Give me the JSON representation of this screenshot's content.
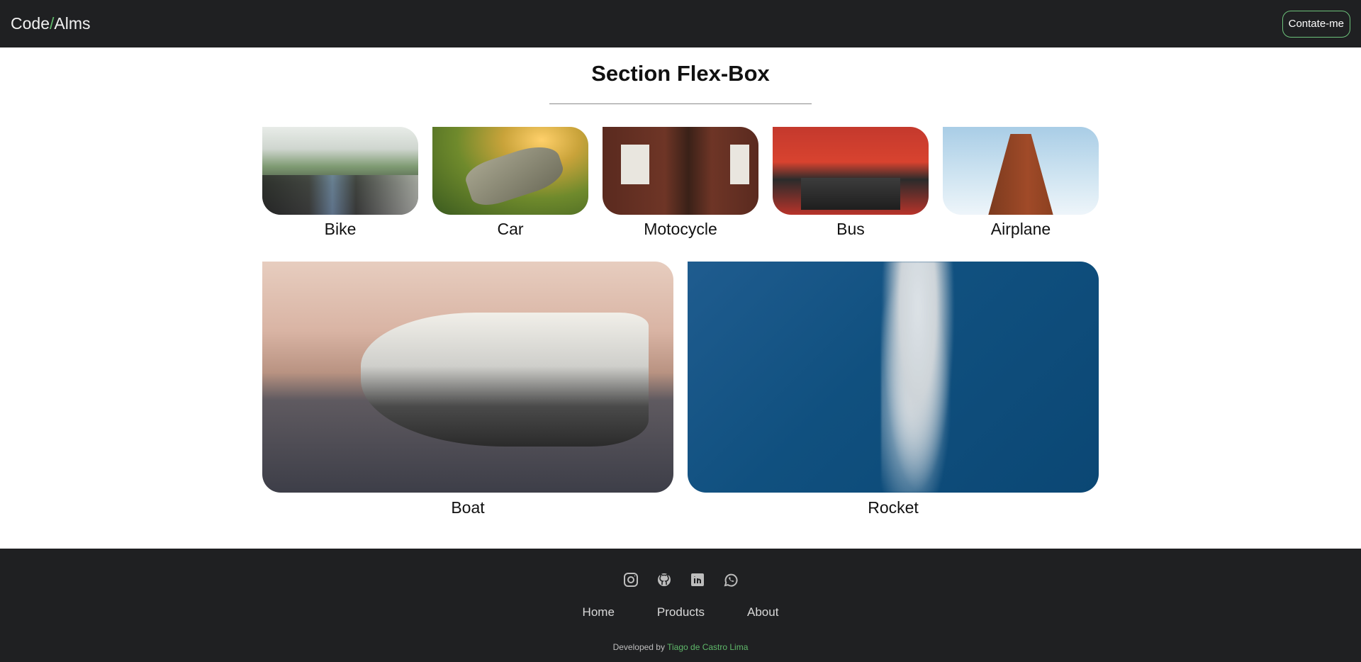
{
  "header": {
    "brand_part1": "Code",
    "brand_slash": "/",
    "brand_part2": "Alms",
    "contact_label": "Contate-me"
  },
  "main": {
    "title": "Section Flex-Box",
    "row1": [
      {
        "label": "Bike",
        "image": "bike-photo"
      },
      {
        "label": "Car",
        "image": "car-photo"
      },
      {
        "label": "Motocycle",
        "image": "building-photo"
      },
      {
        "label": "Bus",
        "image": "red-bus-photo"
      },
      {
        "label": "Airplane",
        "image": "skyscraper-photo"
      }
    ],
    "row2": [
      {
        "label": "Boat",
        "image": "yacht-photo"
      },
      {
        "label": "Rocket",
        "image": "rocket-smoke-photo"
      }
    ]
  },
  "footer": {
    "social_icons": [
      "instagram-icon",
      "github-icon",
      "linkedin-icon",
      "whatsapp-icon"
    ],
    "nav": [
      "Home",
      "Products",
      "About"
    ],
    "credit_prefix": "Developed by",
    "credit_author": "Tiago de Castro Lima"
  },
  "colors": {
    "bar_bg": "#1f2022",
    "accent": "#5fb86a"
  }
}
